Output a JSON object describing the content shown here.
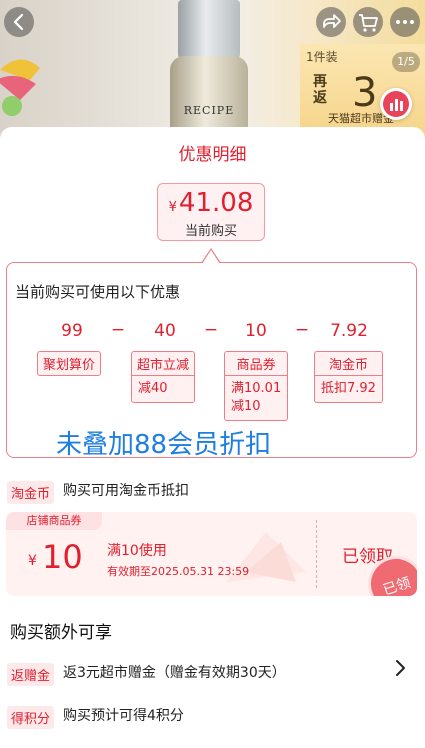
{
  "hero": {
    "bottle_label": "RECIPE",
    "quantity": "1件装",
    "rebate_word": "再返",
    "rebate_amount": "3",
    "rebate_desc": "天猫超市赠金",
    "page_indicator": "1/5"
  },
  "icons": {
    "back": "back-arrow-icon",
    "share": "share-icon",
    "cart": "cart-icon",
    "more": "more-dots-icon",
    "stats": "bar-chart-icon",
    "chevron": "chevron-right-icon"
  },
  "sheet": {
    "title": "优惠明细",
    "price_currency": "¥",
    "price_value": "41.08",
    "price_caption": "当前购买",
    "detail_heading": "当前购买可使用以下优惠",
    "calc": {
      "n1": "99",
      "n2": "40",
      "n3": "10",
      "n4": "7.92",
      "minus": "−"
    },
    "chips": [
      {
        "head": "聚划算价"
      },
      {
        "head": "超市立减",
        "body": "减40"
      },
      {
        "head": "商品券",
        "body1": "满10.01",
        "body2": "减10"
      },
      {
        "head": "淘金币",
        "body": "抵扣7.92"
      }
    ],
    "overlay_note": "未叠加88会员折扣"
  },
  "coin_row": {
    "tag": "淘金币",
    "text": "购买可用淘金币抵扣"
  },
  "coupon": {
    "tag": "店铺商品券",
    "currency": "¥",
    "amount": "10",
    "condition": "满10使用",
    "expiry": "有效期至2025.05.31 23:59",
    "status": "已领取",
    "stamp": "已领"
  },
  "extra": {
    "title": "购买额外可享",
    "rows": [
      {
        "tag": "返赠金",
        "text": "返3元超市赠金（赠金有效期30天）"
      },
      {
        "tag": "得积分",
        "text": "购买预计可得4积分"
      }
    ]
  },
  "colors": {
    "accent": "#e0202f",
    "overlay_note": "#1f7fe0"
  }
}
